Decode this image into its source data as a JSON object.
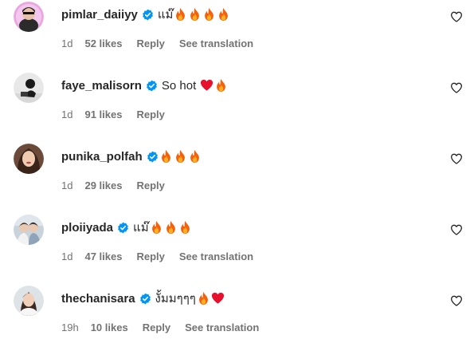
{
  "comments": [
    {
      "username": "pimlar_daiiyy",
      "verified": true,
      "text": "แม๊",
      "emojis": [
        "fire",
        "fire",
        "fire",
        "fire"
      ],
      "time": "1d",
      "likes": "52 likes",
      "reply": "Reply",
      "translate": "See translation"
    },
    {
      "username": "faye_malisorn",
      "verified": true,
      "text": "So hot",
      "emojis": [
        "red-heart",
        "fire"
      ],
      "time": "1d",
      "likes": "91 likes",
      "reply": "Reply",
      "translate": ""
    },
    {
      "username": "punika_polfah",
      "verified": true,
      "text": "",
      "emojis": [
        "fire",
        "fire",
        "fire"
      ],
      "time": "1d",
      "likes": "29 likes",
      "reply": "Reply",
      "translate": ""
    },
    {
      "username": "ploiiyada",
      "verified": true,
      "text": "แม๊",
      "emojis": [
        "fire",
        "fire",
        "fire"
      ],
      "time": "1d",
      "likes": "47 likes",
      "reply": "Reply",
      "translate": "See translation"
    },
    {
      "username": "thechanisara",
      "verified": true,
      "text": "งั้มมๆๆๆ",
      "emojis": [
        "fire",
        "red-heart"
      ],
      "time": "19h",
      "likes": "10 likes",
      "reply": "Reply",
      "translate": "See translation"
    }
  ],
  "icons": {
    "verified": "verified-badge-icon",
    "like": "heart-outline-icon"
  },
  "colors": {
    "verified_blue": "#0095f6",
    "meta_gray": "#737373",
    "text": "#262626"
  }
}
